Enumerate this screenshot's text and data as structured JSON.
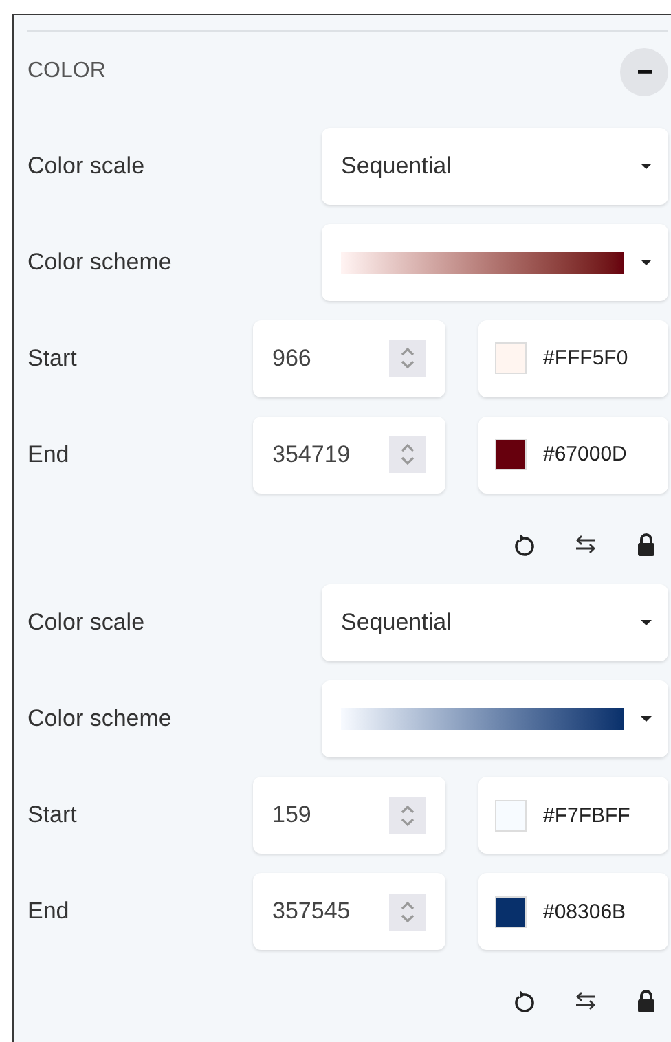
{
  "section": {
    "title": "COLOR",
    "expanded": true
  },
  "groups": [
    {
      "scale": {
        "label": "Color scale",
        "value": "Sequential"
      },
      "scheme": {
        "label": "Color scheme"
      },
      "endpoints": [
        {
          "label": "Start",
          "value": "966",
          "color": "#fff5f0",
          "hex": "#FFF5F0"
        },
        {
          "label": "End",
          "value": "354719",
          "color": "#67000d",
          "hex": "#67000D"
        }
      ]
    },
    {
      "scale": {
        "label": "Color scale",
        "value": "Sequential"
      },
      "scheme": {
        "label": "Color scheme"
      },
      "endpoints": [
        {
          "label": "Start",
          "value": "159",
          "color": "#f7fbff",
          "hex": "#F7FBFF"
        },
        {
          "label": "End",
          "value": "357545",
          "color": "#08306b",
          "hex": "#08306B"
        }
      ]
    }
  ]
}
